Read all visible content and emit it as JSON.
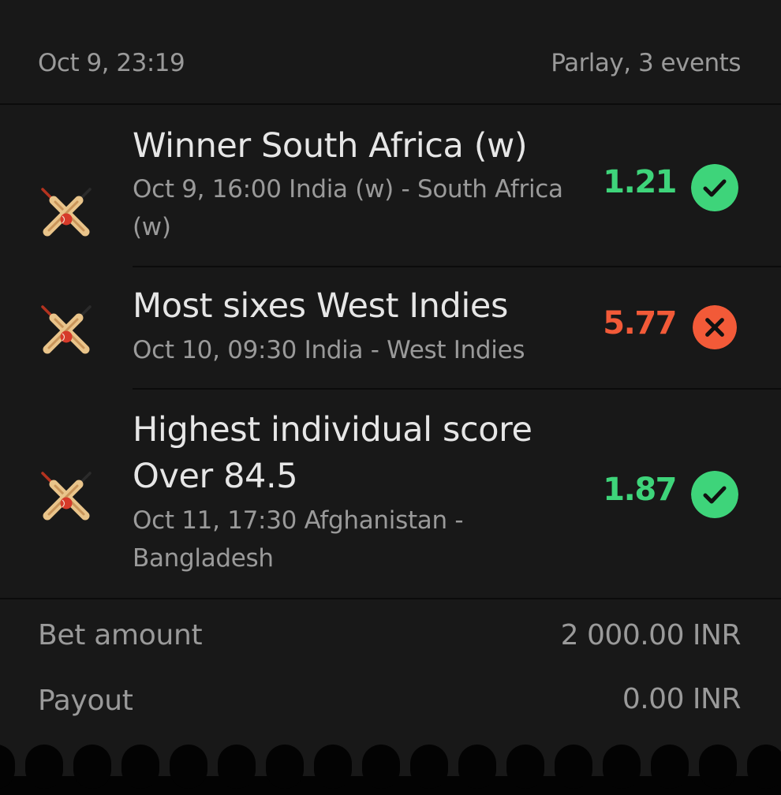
{
  "colors": {
    "win": "#3ed47a",
    "loss": "#f25a38",
    "card_bg": "#181818",
    "text_primary": "#e6e6e6",
    "text_secondary": "#9a9a9a"
  },
  "header": {
    "date": "Oct 9, 23:19",
    "bet_type": "Parlay, 3 events"
  },
  "events": [
    {
      "sport_icon": "cricket-icon",
      "market": "Winner South Africa (w)",
      "match": "Oct 9, 16:00 India (w) - South Africa (w)",
      "odds": "1.21",
      "result": "won",
      "result_icon": "check-icon"
    },
    {
      "sport_icon": "cricket-icon",
      "market": "Most sixes West Indies",
      "match": "Oct 10, 09:30 India - West Indies",
      "odds": "5.77",
      "result": "lost",
      "result_icon": "cross-icon"
    },
    {
      "sport_icon": "cricket-icon",
      "market": "Highest individual score Over 84.5",
      "match": "Oct 11, 17:30 Afghanistan - Bangladesh",
      "odds": "1.87",
      "result": "won",
      "result_icon": "check-icon"
    }
  ],
  "summary": {
    "bet_amount_label": "Bet amount",
    "bet_amount_value": "2 000.00 INR",
    "payout_label": "Payout",
    "payout_value": "0.00 INR"
  }
}
